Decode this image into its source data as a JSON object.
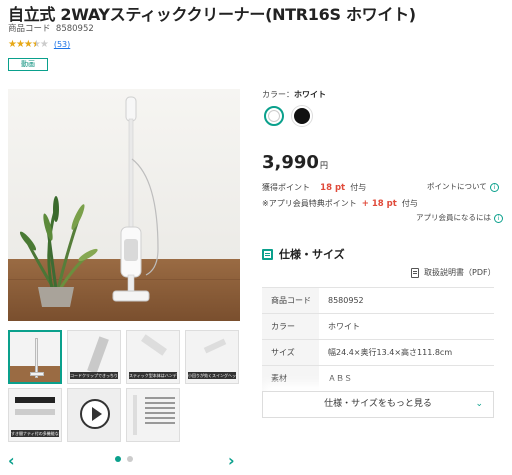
{
  "product": {
    "title": "自立式 2WAYスティッククリーナー(NTR16S ホワイト)",
    "code_label": "商品コード",
    "code_value": "8580952",
    "review_count": "(53)",
    "rating": 3.5,
    "video_badge": "動画"
  },
  "gallery": {
    "thumbnails": [
      {
        "caption": ""
      },
      {
        "caption": "コードクリップできっちり収納"
      },
      {
        "caption": "スティック型本体はハンディクリーナー"
      },
      {
        "caption": "小回りが効くスイングヘッド"
      },
      {
        "caption": "すき間ナティ付の多機能な2WAYノズル"
      },
      {
        "caption": ""
      },
      {
        "caption": ""
      }
    ],
    "active_index": 0,
    "page_count": 2,
    "current_page": 1
  },
  "options": {
    "color_label": "カラー：",
    "color_selected": "ホワイト",
    "swatches": [
      "#ffffff",
      "#111111"
    ]
  },
  "price": {
    "amount": "3,990",
    "currency": "円"
  },
  "points": {
    "label": "獲得ポイント",
    "value": "18 pt",
    "suffix": "付与",
    "about_link": "ポイントについて",
    "app_label": "※アプリ会員特典ポイント",
    "app_value": "+ 18 pt",
    "app_suffix": "付与",
    "app_link": "アプリ会員になるには"
  },
  "spec": {
    "title": "仕様・サイズ",
    "manual_link": "取扱説明書（PDF）",
    "rows": [
      {
        "key": "商品コード",
        "value": "8580952"
      },
      {
        "key": "カラー",
        "value": "ホワイト"
      },
      {
        "key": "サイズ",
        "value": "幅24.4×奥行13.4×高さ111.8cm"
      },
      {
        "key": "素材",
        "value": "ＡＢＳ"
      }
    ],
    "more_button": "仕様・サイズをもっと見る"
  },
  "colors": {
    "accent": "#0aa08c",
    "point_red": "#e04a3a",
    "star": "#e6a817"
  }
}
